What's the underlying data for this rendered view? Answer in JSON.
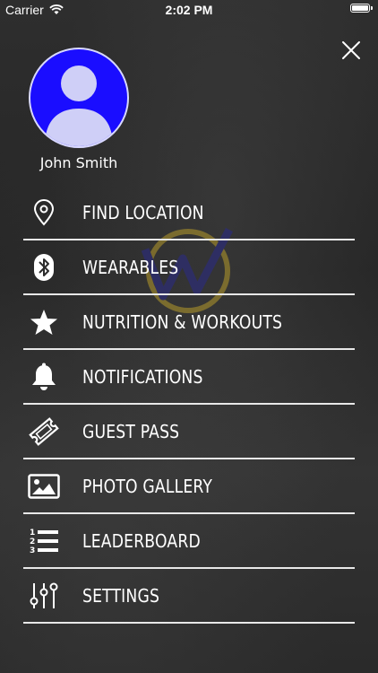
{
  "status_bar": {
    "carrier": "Carrier",
    "time": "2:02 PM",
    "battery_level": 1.0
  },
  "profile": {
    "name": "John Smith",
    "avatar_color": "#1a0dff"
  },
  "menu": {
    "items": [
      {
        "label": "FIND LOCATION",
        "icon": "location-pin-icon"
      },
      {
        "label": "WEARABLES",
        "icon": "bluetooth-icon"
      },
      {
        "label": "NUTRITION & WORKOUTS",
        "icon": "star-icon"
      },
      {
        "label": "NOTIFICATIONS",
        "icon": "bell-icon"
      },
      {
        "label": "GUEST PASS",
        "icon": "ticket-icon"
      },
      {
        "label": "PHOTO GALLERY",
        "icon": "photo-icon"
      },
      {
        "label": "LEADERBOARD",
        "icon": "numbered-list-icon"
      },
      {
        "label": "SETTINGS",
        "icon": "sliders-icon"
      }
    ]
  },
  "colors": {
    "accent": "#1a0dff",
    "divider": "#e8e8e8",
    "background": "#2b2b2b"
  }
}
